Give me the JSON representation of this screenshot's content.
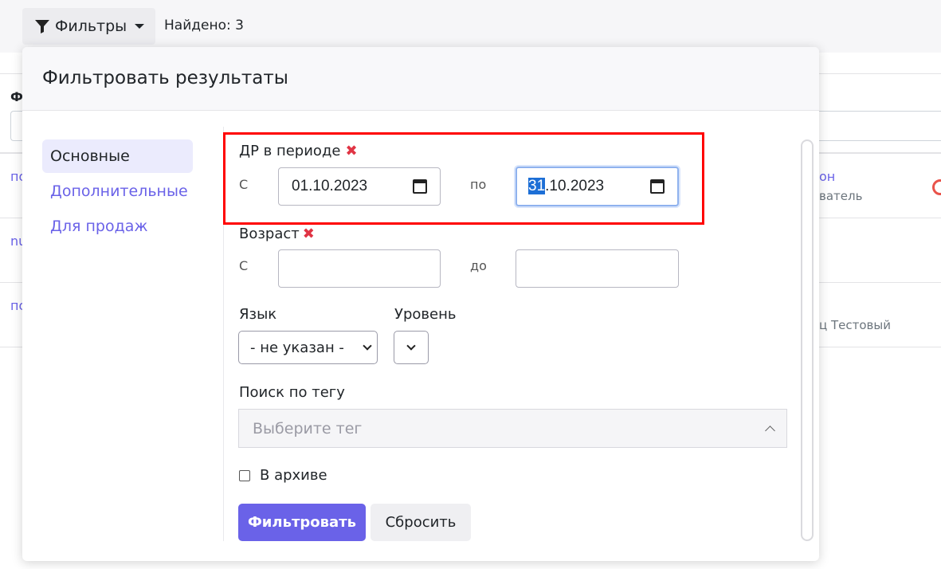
{
  "topbar": {
    "filters_label": "Фильтры",
    "found_label": "Найдено: 3"
  },
  "background": {
    "header_letter": "Ф",
    "row1_left": "по",
    "row2_left": "nu",
    "row3_left": "по",
    "row1_right_link": "он",
    "row1_right_sub": "ватель",
    "row3_right_sub": "ц Тестовый"
  },
  "popup": {
    "title": "Фильтровать результаты",
    "sidebar": {
      "items": [
        {
          "label": "Основные"
        },
        {
          "label": "Дополнительные"
        },
        {
          "label": "Для продаж"
        }
      ]
    },
    "birthday": {
      "label": "ДР в периоде",
      "from_label": "С",
      "from_value": "01.10.2023",
      "to_label": "по",
      "to_day_selected": "31",
      "to_rest": ".10.2023"
    },
    "age": {
      "label": "Возраст",
      "from_label": "С",
      "from_value": "",
      "to_label": "до",
      "to_value": ""
    },
    "language": {
      "label": "Язык",
      "selected": "- не указан -"
    },
    "level": {
      "label": "Уровень",
      "selected": ""
    },
    "tag": {
      "label": "Поиск по тегу",
      "placeholder": "Выберите тег"
    },
    "archive": {
      "label": "В архиве",
      "checked": false
    },
    "buttons": {
      "filter": "Фильтровать",
      "reset": "Сбросить"
    }
  },
  "colors": {
    "accent": "#6a62e8",
    "highlight_box": "#ff0000",
    "clear_icon": "#e03444"
  }
}
